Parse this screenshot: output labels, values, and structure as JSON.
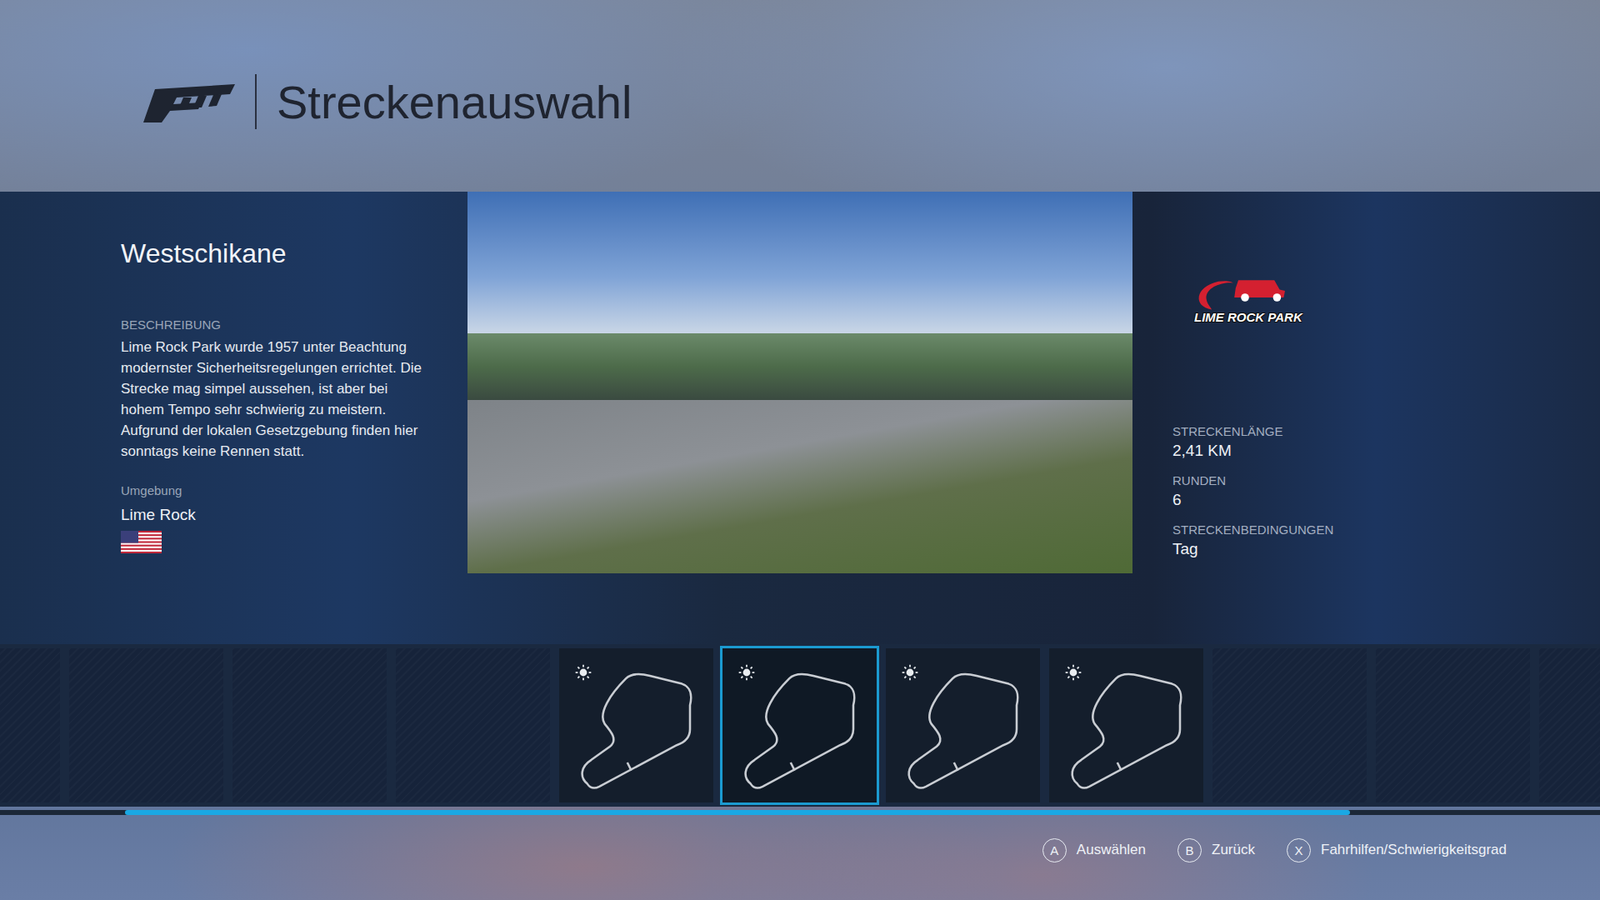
{
  "header": {
    "title": "Streckenauswahl"
  },
  "track": {
    "name": "Westschikane",
    "description_label": "BESCHREIBUNG",
    "description": "Lime Rock Park wurde 1957 unter Beachtung modernster Sicherheitsregelungen errichtet. Die Strecke mag simpel aussehen, ist aber bei hohem Tempo sehr schwierig zu meistern. Aufgrund der lokalen Gesetzgebung finden hier sonntags keine Rennen statt.",
    "environment_label": "Umgebung",
    "environment": "Lime Rock",
    "logo_text": "LIME ROCK PARK"
  },
  "stats": [
    {
      "label": "STRECKENLÄNGE",
      "value": "2,41 KM"
    },
    {
      "label": "RUNDEN",
      "value": "6"
    },
    {
      "label": "STRECKENBEDINGUNGEN",
      "value": "Tag"
    }
  ],
  "layouts": [
    {
      "kind": "empty",
      "selected": false
    },
    {
      "kind": "empty",
      "selected": false
    },
    {
      "kind": "empty",
      "selected": false
    },
    {
      "kind": "empty",
      "selected": false
    },
    {
      "kind": "track",
      "selected": false
    },
    {
      "kind": "track",
      "selected": true
    },
    {
      "kind": "track",
      "selected": false
    },
    {
      "kind": "track",
      "selected": false
    },
    {
      "kind": "empty",
      "selected": false
    },
    {
      "kind": "empty",
      "selected": false
    },
    {
      "kind": "empty",
      "selected": false
    }
  ],
  "scrollbar": {
    "offset": 0.078,
    "level": 0.766
  },
  "hints": [
    {
      "key": "A",
      "label": "Auswählen"
    },
    {
      "key": "B",
      "label": "Zurück"
    },
    {
      "key": "X",
      "label": "Fahrhilfen/Schwierigkeitsgrad"
    }
  ]
}
